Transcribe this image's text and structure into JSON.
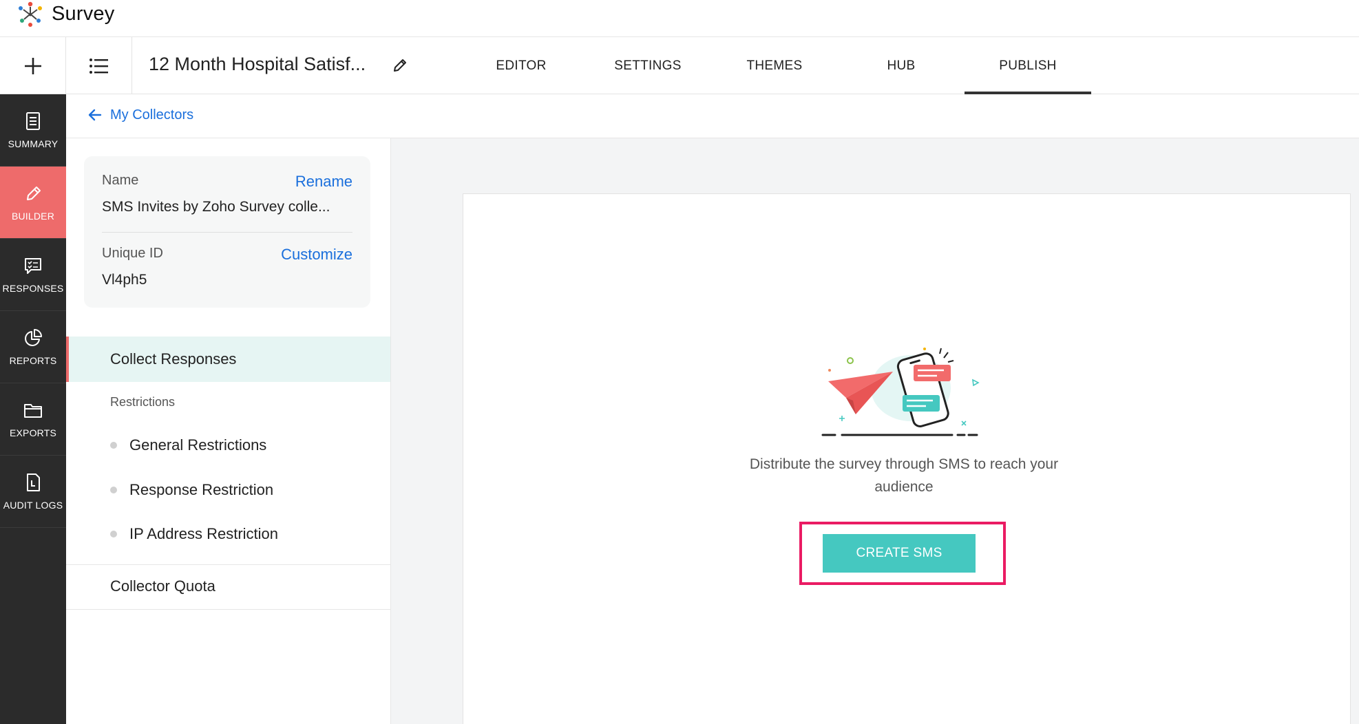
{
  "app": {
    "name": "Survey"
  },
  "topbar": {
    "survey_title": "12 Month Hospital Satisf...",
    "tabs": [
      {
        "label": "EDITOR",
        "active": false
      },
      {
        "label": "SETTINGS",
        "active": false
      },
      {
        "label": "THEMES",
        "active": false
      },
      {
        "label": "HUB",
        "active": false
      },
      {
        "label": "PUBLISH",
        "active": true
      }
    ]
  },
  "sidebar": {
    "items": [
      {
        "label": "SUMMARY",
        "icon": "summary-icon",
        "active": false
      },
      {
        "label": "BUILDER",
        "icon": "pencil-icon",
        "active": true
      },
      {
        "label": "RESPONSES",
        "icon": "responses-icon",
        "active": false
      },
      {
        "label": "REPORTS",
        "icon": "pie-chart-icon",
        "active": false
      },
      {
        "label": "EXPORTS",
        "icon": "folder-icon",
        "active": false
      },
      {
        "label": "AUDIT LOGS",
        "icon": "audit-log-icon",
        "active": false
      }
    ]
  },
  "breadcrumb": {
    "label": "My Collectors"
  },
  "collector": {
    "name_label": "Name",
    "rename_label": "Rename",
    "name_value": "SMS Invites by Zoho Survey colle...",
    "uid_label": "Unique ID",
    "customize_label": "Customize",
    "uid_value": "Vl4ph5"
  },
  "panel": {
    "collect_responses": "Collect Responses",
    "restrictions": "Restrictions",
    "sub_items": [
      "General Restrictions",
      "Response Restriction",
      "IP Address Restriction"
    ],
    "collector_quota": "Collector Quota"
  },
  "main": {
    "description": "Distribute the survey through SMS to reach your audience",
    "create_button": "CREATE SMS"
  },
  "colors": {
    "accent": "#45c8c0",
    "active_nav": "#ee6b6b",
    "link": "#1a6fdc",
    "highlight_border": "#ea1b63"
  }
}
